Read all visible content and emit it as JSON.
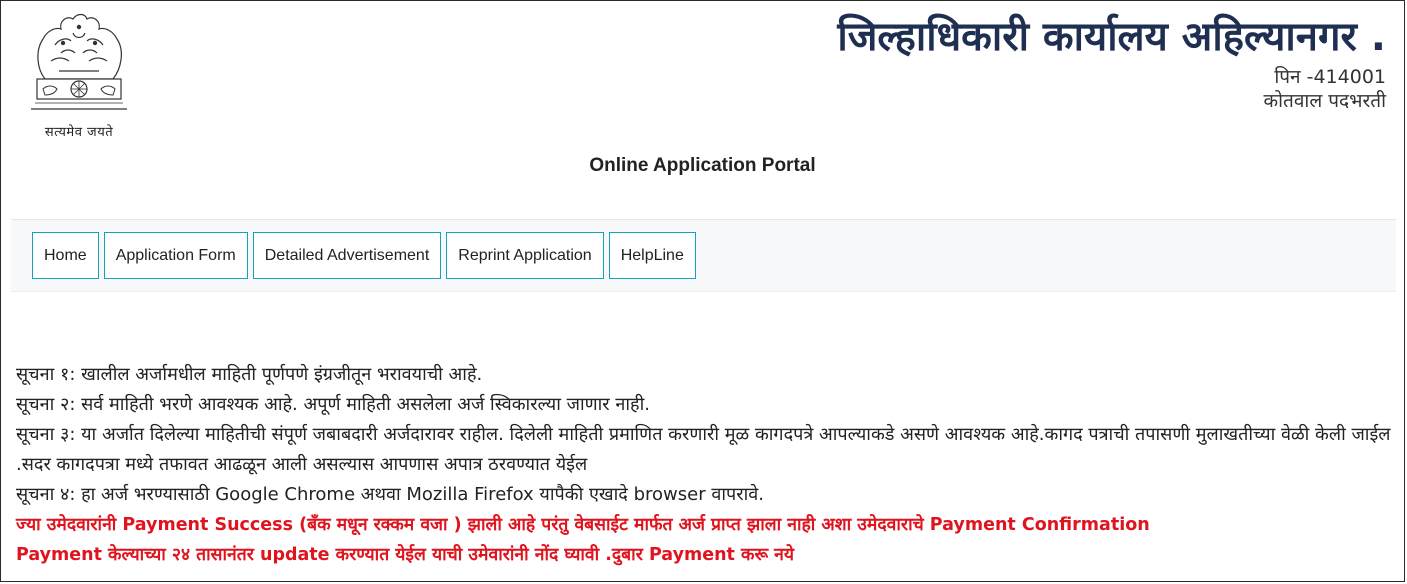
{
  "header": {
    "emblem_motto": "सत्यमेव जयते",
    "office_title": "जिल्हाधिकारी कार्यालय अहिल्यानगर .",
    "pin": "पिन -414001",
    "post": "कोतवाल पदभरती",
    "portal_title": "Online Application Portal"
  },
  "nav": {
    "items": [
      {
        "label": "Home"
      },
      {
        "label": "Application Form"
      },
      {
        "label": "Detailed Advertisement"
      },
      {
        "label": "Reprint Application"
      },
      {
        "label": "HelpLine"
      }
    ],
    "border_color": "#17a2b8"
  },
  "notices": {
    "lines": [
      "सूचना १: खालील अर्जामधील माहिती पूर्णपणे इंग्रजीतून भरावयाची आहे.",
      "सूचना २: सर्व माहिती भरणे आवश्यक आहे. अपूर्ण माहिती असलेला अर्ज स्विकारल्या जाणार नाही.",
      "सूचना ३: या अर्जात दिलेल्या माहितीची संपूर्ण जबाबदारी अर्जदारावर राहील. दिलेली माहिती प्रमाणित करणारी मूळ कागदपत्रे आपल्याकडे असणे आवश्यक आहे.कागद पत्राची तपासणी मुलाखतीच्या वेळी केली जाईल .सदर कागदपत्रा मध्ये तफावत आढळून आली असल्यास आपणास अपात्र ठरवण्यात येईल",
      "सूचना ४: हा अर्ज भरण्यासाठी Google Chrome अथवा Mozilla Firefox यापैकी एखादे browser वापरावे."
    ],
    "red_lines": [
      "ज्या उमेदवारांनी Payment Success (बँक मधून रक्कम वजा ) झाली आहे परंतु वेबसाईट मार्फत अर्ज प्राप्त झाला नाही अशा उमेदवाराचे Payment Confirmation",
      "Payment केल्याच्या २४ तासानंतर update करण्यात येईल याची उमेवारांनी नोंद घ्यावी .दुबार Payment करू नये"
    ],
    "red_color": "#e0141e"
  },
  "colors": {
    "title": "#1f2f52",
    "navbar_bg": "#f7f8f9"
  }
}
